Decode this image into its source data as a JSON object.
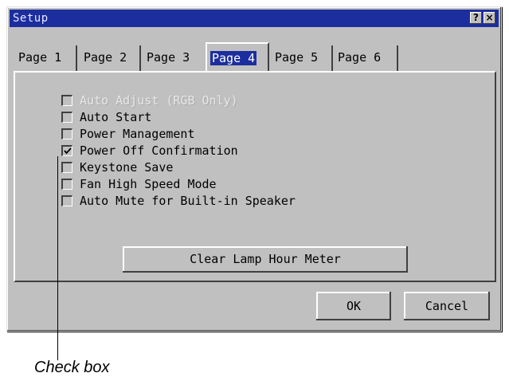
{
  "window": {
    "title": "Setup",
    "help_label": "?",
    "close_label": "×"
  },
  "tabs": [
    {
      "label": "Page 1",
      "active": false
    },
    {
      "label": "Page 2",
      "active": false
    },
    {
      "label": "Page 3",
      "active": false
    },
    {
      "label": "Page 4",
      "active": true
    },
    {
      "label": "Page 5",
      "active": false
    },
    {
      "label": "Page 6",
      "active": false
    }
  ],
  "options": [
    {
      "label": "Auto Adjust (RGB Only)",
      "checked": false,
      "enabled": false
    },
    {
      "label": "Auto Start",
      "checked": false,
      "enabled": true
    },
    {
      "label": "Power Management",
      "checked": false,
      "enabled": true
    },
    {
      "label": "Power Off Confirmation",
      "checked": true,
      "enabled": true
    },
    {
      "label": "Keystone Save",
      "checked": false,
      "enabled": true
    },
    {
      "label": "Fan High Speed Mode",
      "checked": false,
      "enabled": true
    },
    {
      "label": "Auto Mute for Built-in Speaker",
      "checked": false,
      "enabled": true
    }
  ],
  "clear_lamp_label": "Clear Lamp Hour Meter",
  "ok_label": "OK",
  "cancel_label": "Cancel",
  "caption": "Check box",
  "colors": {
    "titlebar": "#1c2e9e",
    "face": "#c0c0c0",
    "highlight": "#ffffff",
    "shadow": "#404040"
  }
}
